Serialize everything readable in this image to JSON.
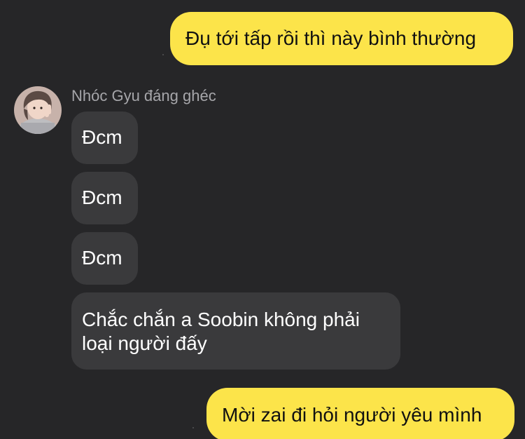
{
  "conversation": {
    "contact_name": "Nhóc Gyu đáng ghéc",
    "messages": [
      {
        "direction": "outgoing",
        "text": "Đụ tới tấp rồi thì này bình thường"
      },
      {
        "direction": "incoming",
        "text": "Đcm"
      },
      {
        "direction": "incoming",
        "text": "Đcm"
      },
      {
        "direction": "incoming",
        "text": "Đcm"
      },
      {
        "direction": "incoming",
        "lines": [
          "Chắc chắn a Soobin không phải",
          "loại người đấy"
        ]
      },
      {
        "direction": "outgoing",
        "text": "Mời zai đi hỏi người yêu mình"
      }
    ]
  },
  "colors": {
    "background": "#262628",
    "outgoing_bubble": "#fce44a",
    "incoming_bubble": "#3a3a3c",
    "sender_name": "#a6a6aa"
  }
}
